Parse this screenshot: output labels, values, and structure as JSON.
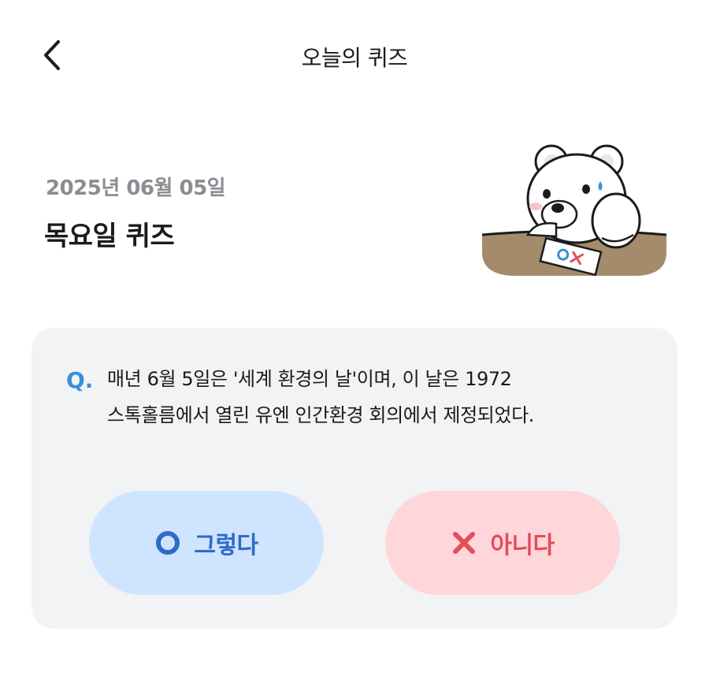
{
  "header": {
    "title": "오늘의 퀴즈",
    "back_icon": "chevron-left-icon"
  },
  "quiz": {
    "date": "2025년 06월 05일",
    "day_title": "목요일 퀴즈",
    "mascot": "bear-mascot-with-ox-paper",
    "question_marker": "Q.",
    "question_line1": "매년 6월 5일은 '세계 환경의 날'이며, 이 날은 1972",
    "question_line2": "스톡홀름에서 열린 유엔 인간환경 회의에서 제정되었다."
  },
  "answers": {
    "yes_label": "그렇다",
    "yes_icon": "circle-o-icon",
    "no_label": "아니다",
    "no_icon": "x-mark-icon"
  },
  "colors": {
    "accent_blue": "#3a8fd8",
    "yes_bg": "#cfe4ff",
    "no_bg": "#ffd6da",
    "no_red": "#e34d58",
    "card_bg": "#f2f3f5"
  }
}
